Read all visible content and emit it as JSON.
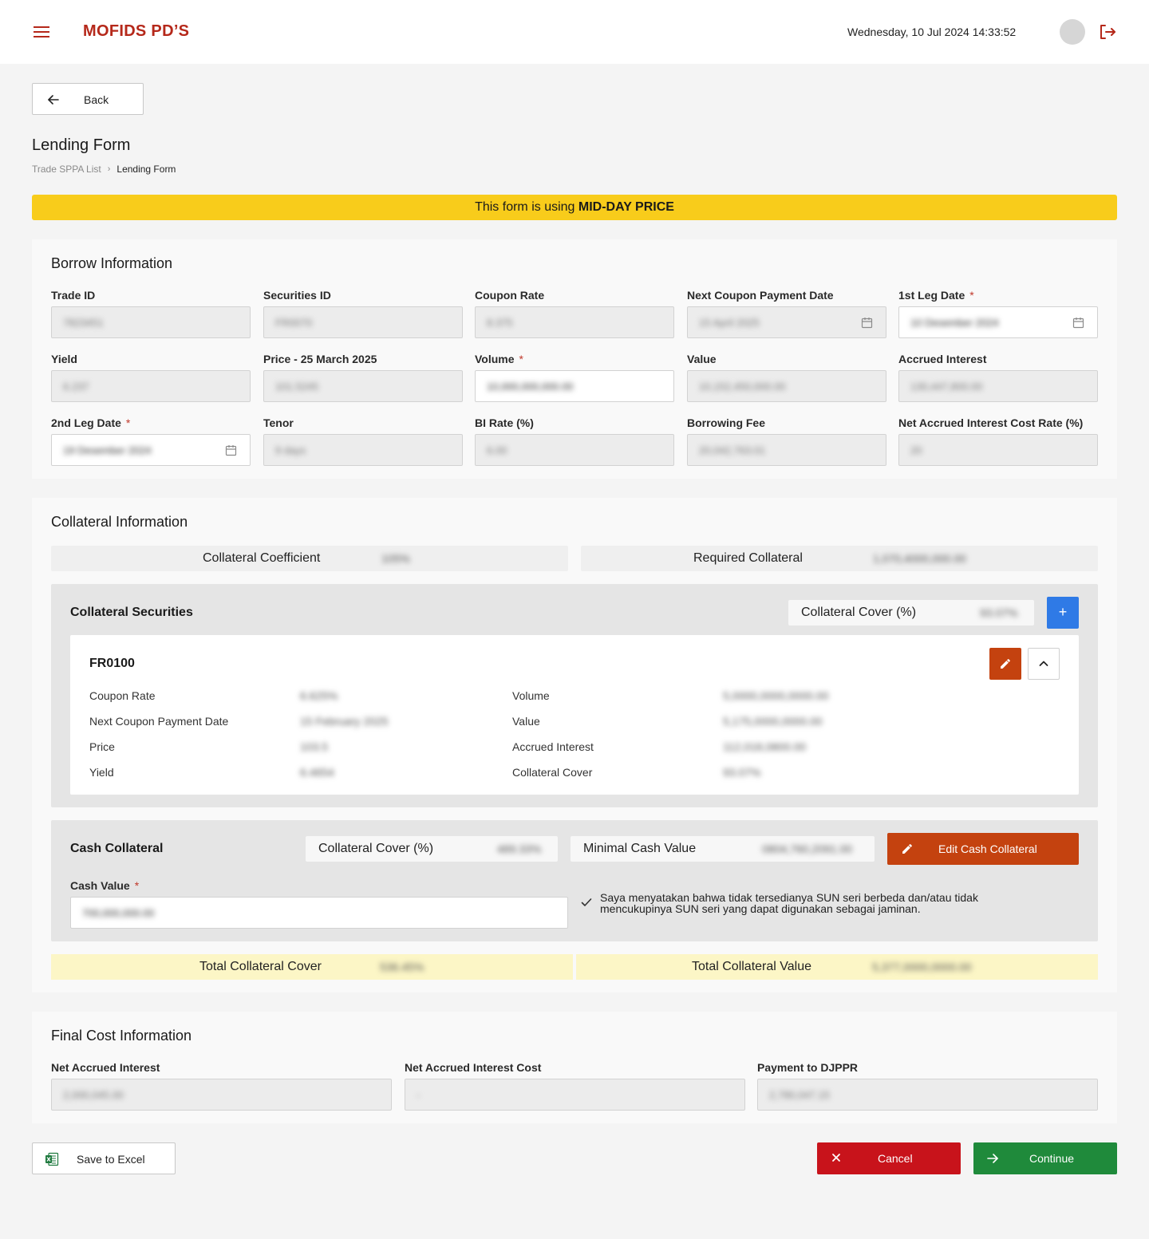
{
  "header": {
    "app_title": "MOFIDS PD’S",
    "datetime": "Wednesday, 10 Jul 2024 14:33:52"
  },
  "nav": {
    "back_label": "Back",
    "page_title": "Lending Form",
    "breadcrumb": [
      "Trade SPPA List",
      "Lending Form"
    ]
  },
  "banner": {
    "prefix": "This form is using ",
    "emphasis": "MID-DAY PRICE"
  },
  "borrow": {
    "title": "Borrow Information",
    "fields": [
      {
        "label": "Trade ID",
        "value": "7823451",
        "required": false
      },
      {
        "label": "Securities ID",
        "value": "FR0070",
        "required": false
      },
      {
        "label": "Coupon Rate",
        "value": "8.375",
        "required": false
      },
      {
        "label": "Next Coupon Payment Date",
        "value": "15 April 2025",
        "required": false
      },
      {
        "label": "1st Leg Date",
        "value": "10 Desember 2024",
        "required": true
      },
      {
        "label": "Yield",
        "value": "6.237",
        "required": false
      },
      {
        "label": "Price - 25 March 2025",
        "value": "101.5245",
        "required": false
      },
      {
        "label": "Volume",
        "value": "10,000,000,000.00",
        "required": true
      },
      {
        "label": "Value",
        "value": "10,152,450,000.00",
        "required": false
      },
      {
        "label": "Accrued Interest",
        "value": "130,447,800.00",
        "required": false
      },
      {
        "label": "2nd Leg Date",
        "value": "19 Desember 2024",
        "required": true
      },
      {
        "label": "Tenor",
        "value": "9 days",
        "required": false
      },
      {
        "label": "BI Rate (%)",
        "value": "6.00",
        "required": false
      },
      {
        "label": "Borrowing Fee",
        "value": "20,042,763.01",
        "required": false
      },
      {
        "label": "Net Accrued Interest Cost Rate (%)",
        "value": "20",
        "required": false
      }
    ]
  },
  "collateral": {
    "title": "Collateral Information",
    "coefficient_label": "Collateral Coefficient",
    "coefficient_value": "105%",
    "required_label": "Required Collateral",
    "required_value": "1,070,4000,000.00",
    "securities": {
      "title": "Collateral Securities",
      "cover_label": "Collateral Cover (%)",
      "cover_value": "93.07%",
      "add_label": "+",
      "item": {
        "name": "FR0100",
        "left": [
          {
            "label": "Coupon Rate",
            "value": "6.625%"
          },
          {
            "label": "Next Coupon Payment Date",
            "value": "15 February 2025"
          },
          {
            "label": "Price",
            "value": "103.5"
          },
          {
            "label": "Yield",
            "value": "6.4654"
          }
        ],
        "right": [
          {
            "label": "Volume",
            "value": "5,0000,0000,0000.00"
          },
          {
            "label": "Value",
            "value": "5,175,0000,0000.00"
          },
          {
            "label": "Accrued Interest",
            "value": "112,018,0800.00"
          },
          {
            "label": "Collateral Cover",
            "value": "93.07%"
          }
        ]
      }
    },
    "cash": {
      "title": "Cash Collateral",
      "cover_label": "Collateral Cover (%)",
      "cover_value": "489.33%",
      "minimal_label": "Minimal Cash Value",
      "minimal_value": "0804,760,2091.00",
      "edit_label": "Edit Cash Collateral",
      "cash_value_label": "Cash Value",
      "cash_value": "700,000,000.00",
      "declaration": "Saya menyatakan bahwa tidak tersedianya SUN seri berbeda dan/atau tidak mencukupinya SUN seri yang dapat digunakan sebagai jaminan."
    },
    "total_cover_label": "Total Collateral Cover",
    "total_cover_value": "536.45%",
    "total_value_label": "Total Collateral Value",
    "total_value_value": "5,377,0000,0000.00"
  },
  "final_cost": {
    "title": "Final Cost Information",
    "fields": [
      {
        "label": "Net Accrued Interest",
        "value": "2,000,045.00"
      },
      {
        "label": "Net Accrued Interest Cost",
        "value": "-"
      },
      {
        "label": "Payment to DJPPR",
        "value": "2,780,047.15"
      }
    ]
  },
  "actions": {
    "excel_label": "Save to Excel",
    "cancel_label": "Cancel",
    "continue_label": "Continue"
  },
  "colors": {
    "brand": "#b5281a",
    "banner": "#f8cc1b",
    "primary_blue": "#2f7ae6",
    "edit_orange": "#c4420f",
    "cancel_red": "#c8131b",
    "continue_green": "#1f8a3b",
    "total_highlight": "#fcf6c6"
  }
}
